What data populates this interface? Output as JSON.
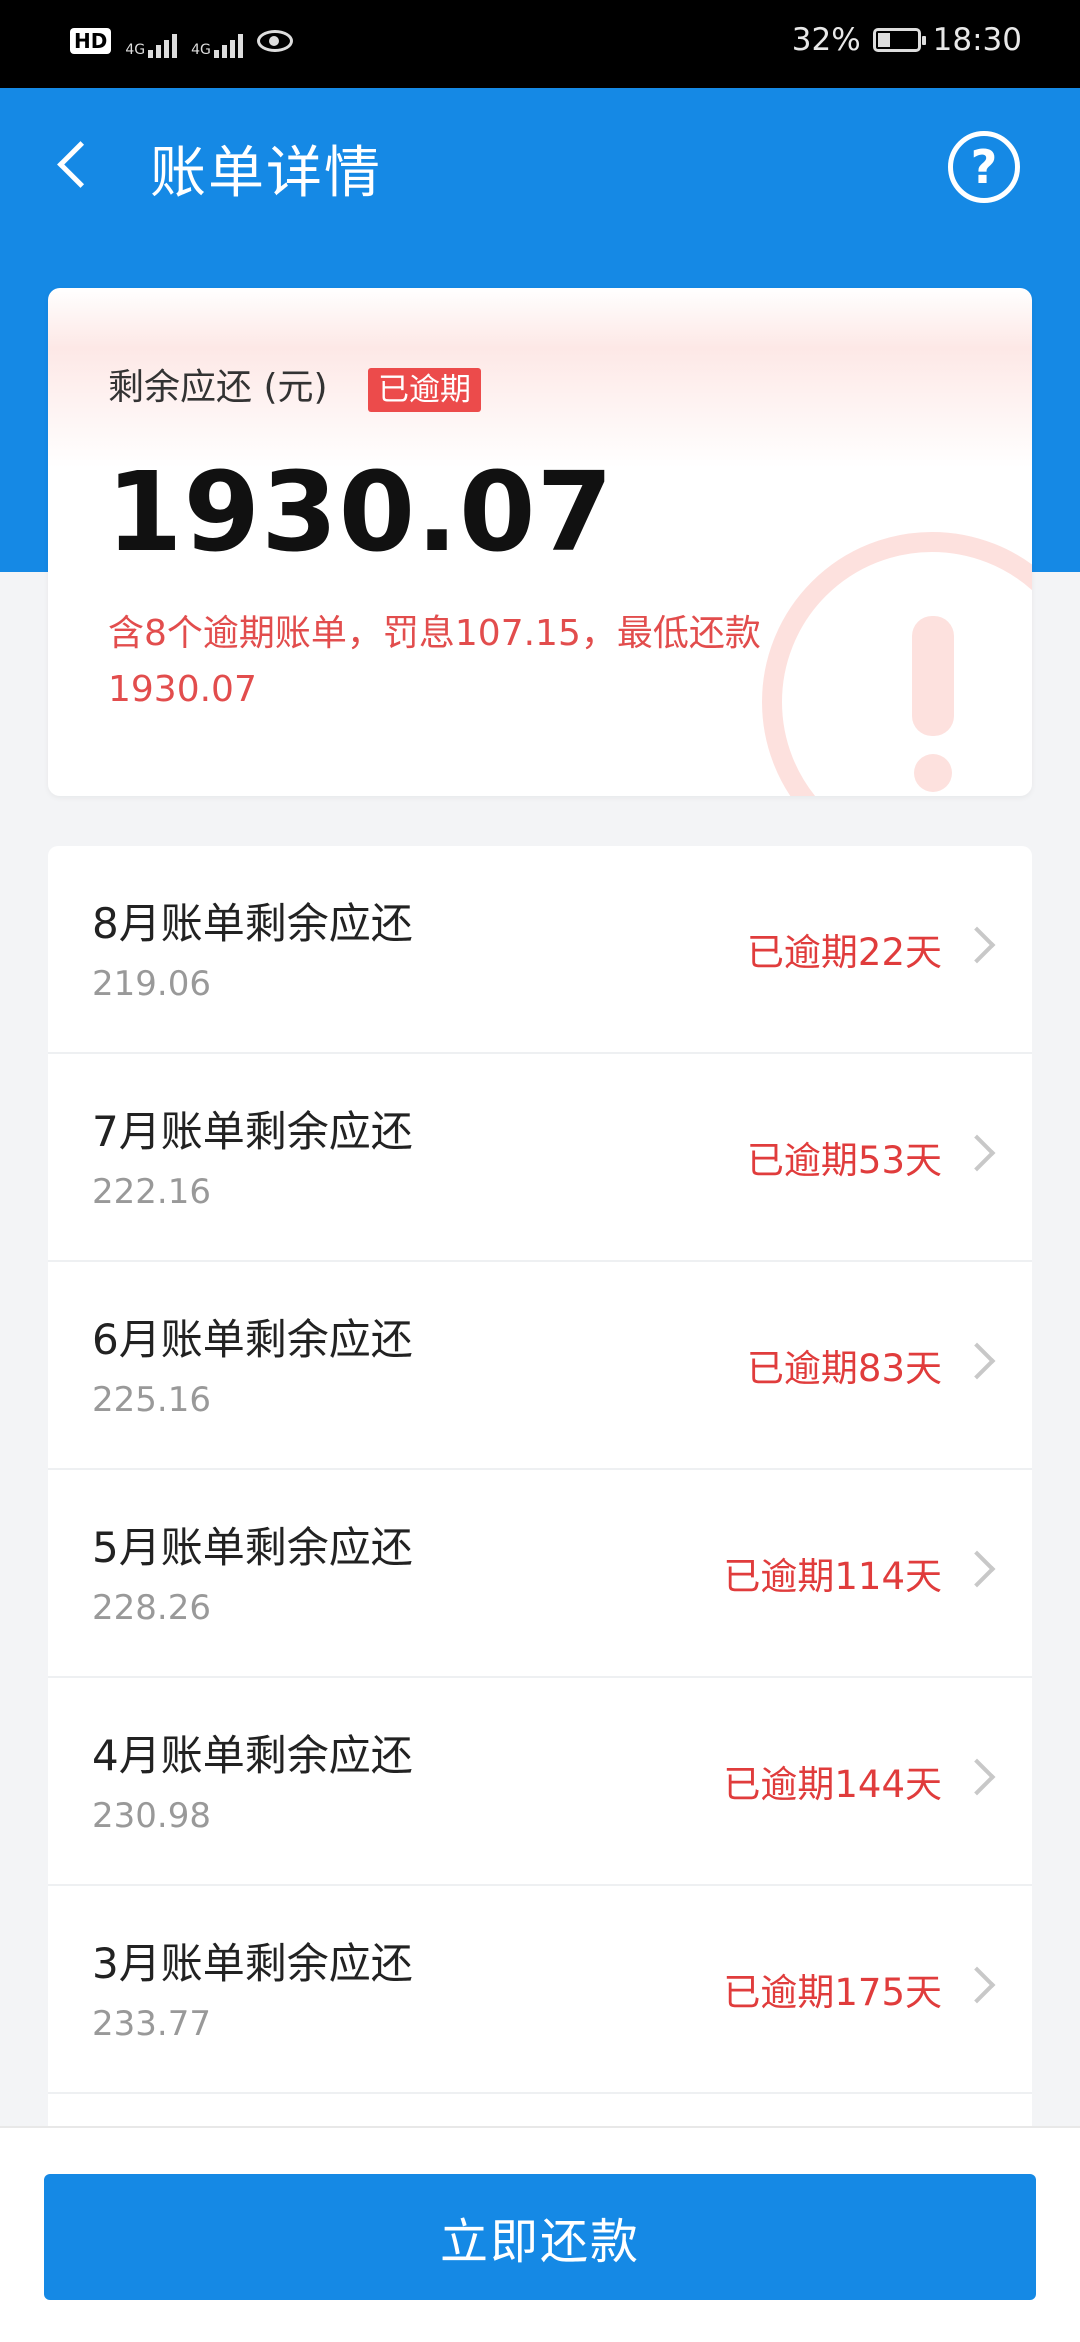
{
  "status_bar": {
    "hd": "HD",
    "sim1": "4G",
    "sim2": "4G",
    "battery_percent": "32%",
    "time": "18:30"
  },
  "header": {
    "title": "账单详情"
  },
  "summary": {
    "label": "剩余应还 (元)",
    "badge": "已逾期",
    "amount": "1930.07",
    "note": "含8个逾期账单，罚息107.15，最低还款1930.07"
  },
  "bills": [
    {
      "title": "8月账单剩余应还",
      "value": "219.06",
      "status": "已逾期22天"
    },
    {
      "title": "7月账单剩余应还",
      "value": "222.16",
      "status": "已逾期53天"
    },
    {
      "title": "6月账单剩余应还",
      "value": "225.16",
      "status": "已逾期83天"
    },
    {
      "title": "5月账单剩余应还",
      "value": "228.26",
      "status": "已逾期114天"
    },
    {
      "title": "4月账单剩余应还",
      "value": "230.98",
      "status": "已逾期144天"
    },
    {
      "title": "3月账单剩余应还",
      "value": "233.77",
      "status": "已逾期175天"
    }
  ],
  "footer": {
    "pay_label": "立即还款"
  },
  "colors": {
    "primary": "#1589e5",
    "overdue": "#e03c3c"
  }
}
